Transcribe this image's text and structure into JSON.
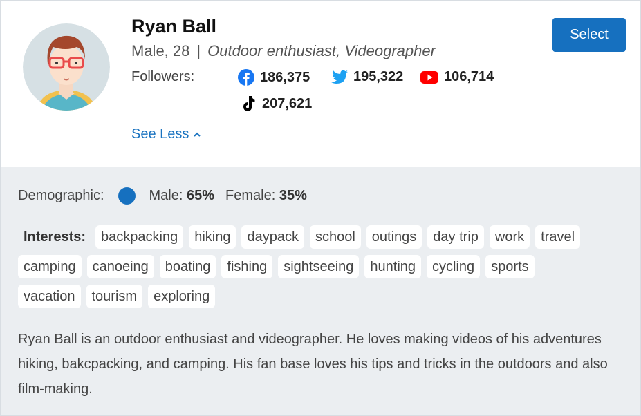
{
  "profile": {
    "name": "Ryan Ball",
    "gender_age": "Male, 28",
    "separator": "|",
    "description": "Outdoor enthusiast, Videographer",
    "followers_label": "Followers:",
    "followers": {
      "facebook": "186,375",
      "twitter": "195,322",
      "youtube": "106,714",
      "tiktok": "207,621"
    },
    "see_less": "See Less",
    "select_label": "Select"
  },
  "demographic": {
    "label": "Demographic:",
    "male_label": "Male:",
    "male_value": "65%",
    "female_label": "Female:",
    "female_value": "35%"
  },
  "interests": {
    "label": "Interests:",
    "row1": [
      "backpacking",
      "hiking",
      "daypack",
      "school",
      "outings",
      "day trip",
      "work",
      "travel"
    ],
    "row2": [
      "camping",
      "canoeing",
      "boating",
      "fishing",
      "sightseeing",
      "hunting",
      "cycling",
      "sports"
    ],
    "row3": [
      "vacation",
      "tourism",
      "exploring"
    ]
  },
  "bio": "Ryan Ball is an outdoor enthusiast and videographer. He loves making videos of his adventures hiking, bakcpacking, and camping. His fan base loves his tips and tricks in the outdoors and also film-making.",
  "colors": {
    "accent": "#1670bf",
    "facebook": "#1877f2",
    "twitter": "#1da1f2",
    "youtube": "#ff0000",
    "tiktok": "#000000",
    "panel": "#ebeef1"
  }
}
